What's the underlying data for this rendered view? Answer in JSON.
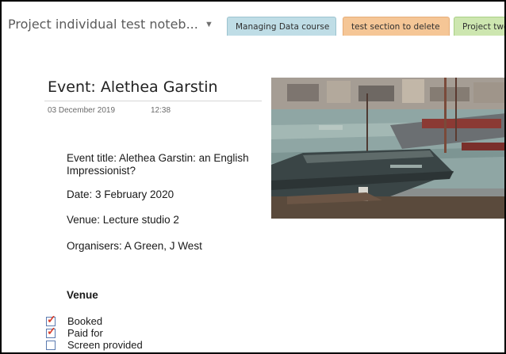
{
  "window": {
    "notebook_name": "Project individual test noteb...",
    "notebook_dropdown": "▼",
    "tabs": [
      {
        "label": "Managing Data course",
        "color": "#bfdde6"
      },
      {
        "label": "test section to delete",
        "color": "#f5c696"
      },
      {
        "label": "Project two",
        "color": "#cde6b0"
      }
    ]
  },
  "page": {
    "title": "Event: Alethea Garstin",
    "date": "03 December 2019",
    "time": "12:38",
    "lines": {
      "event_title": "Event title: Alethea Garstin: an English Impressionist?",
      "date": "Date: 3 February 2020",
      "venue": "Venue: Lecture studio 2",
      "organisers": "Organisers: A Green, J West"
    },
    "venue_heading": "Venue",
    "todos": [
      {
        "label": "Booked",
        "checked": true
      },
      {
        "label": "Paid for",
        "checked": true
      },
      {
        "label": "Screen provided",
        "checked": false
      }
    ],
    "image_icon": "harbour-painting-image"
  }
}
